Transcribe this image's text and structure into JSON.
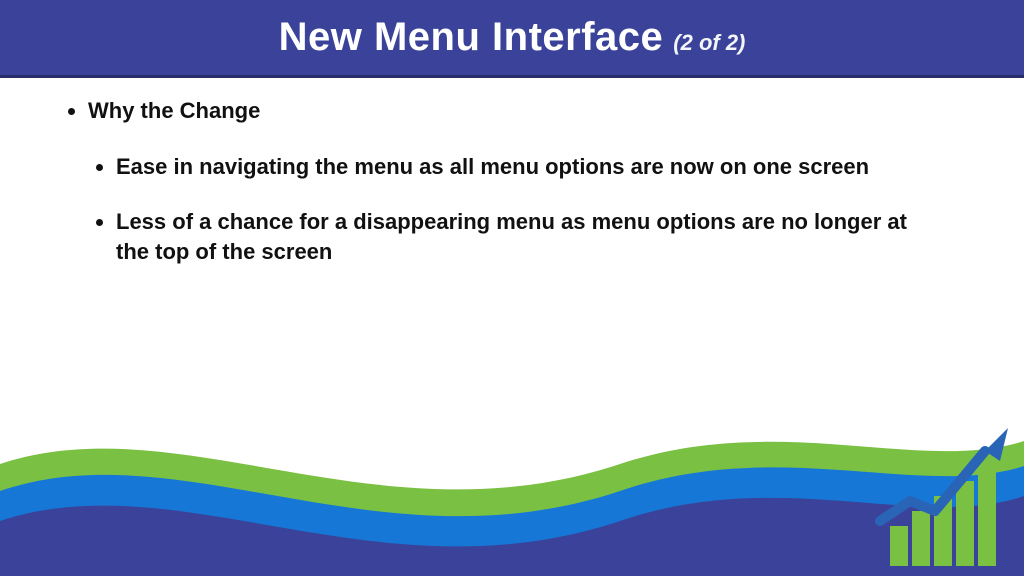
{
  "header": {
    "title": "New Menu Interface",
    "page_indicator": "(2 of 2)"
  },
  "body": {
    "heading": "Why the Change",
    "bullets": [
      "Ease in navigating the menu as all menu options are now on one screen",
      "Less of a chance for a disappearing menu as menu options are no longer at the top of the screen"
    ]
  }
}
